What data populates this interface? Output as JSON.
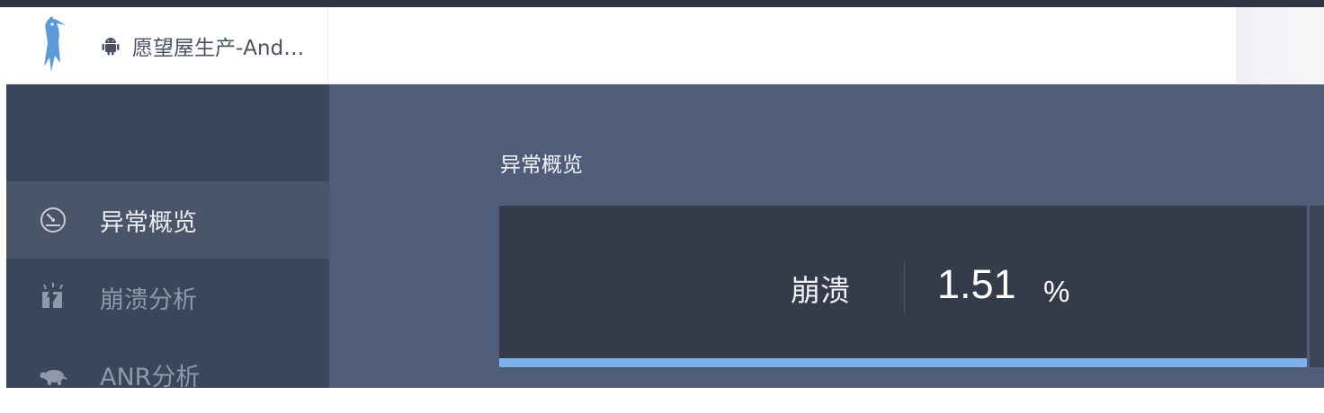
{
  "header": {
    "app_name": "愿望屋生产-Android",
    "logo_icon": "woodpecker-logo-icon",
    "platform_icon": "android-icon"
  },
  "sidebar": {
    "items": [
      {
        "label": "异常概览",
        "icon": "dashboard-gauge-icon",
        "active": true
      },
      {
        "label": "崩溃分析",
        "icon": "crash-lightning-icon",
        "active": false
      },
      {
        "label": "ANR分析",
        "icon": "turtle-icon",
        "active": false
      }
    ]
  },
  "main": {
    "section_title": "异常概览",
    "crash_card": {
      "label": "崩溃",
      "value": "1.51",
      "unit": "%"
    }
  },
  "colors": {
    "sidebar_bg": "#3a465b",
    "main_bg": "#4f5d7a",
    "card_bg": "#343c4c",
    "accent_bar": "#7db3ec"
  }
}
